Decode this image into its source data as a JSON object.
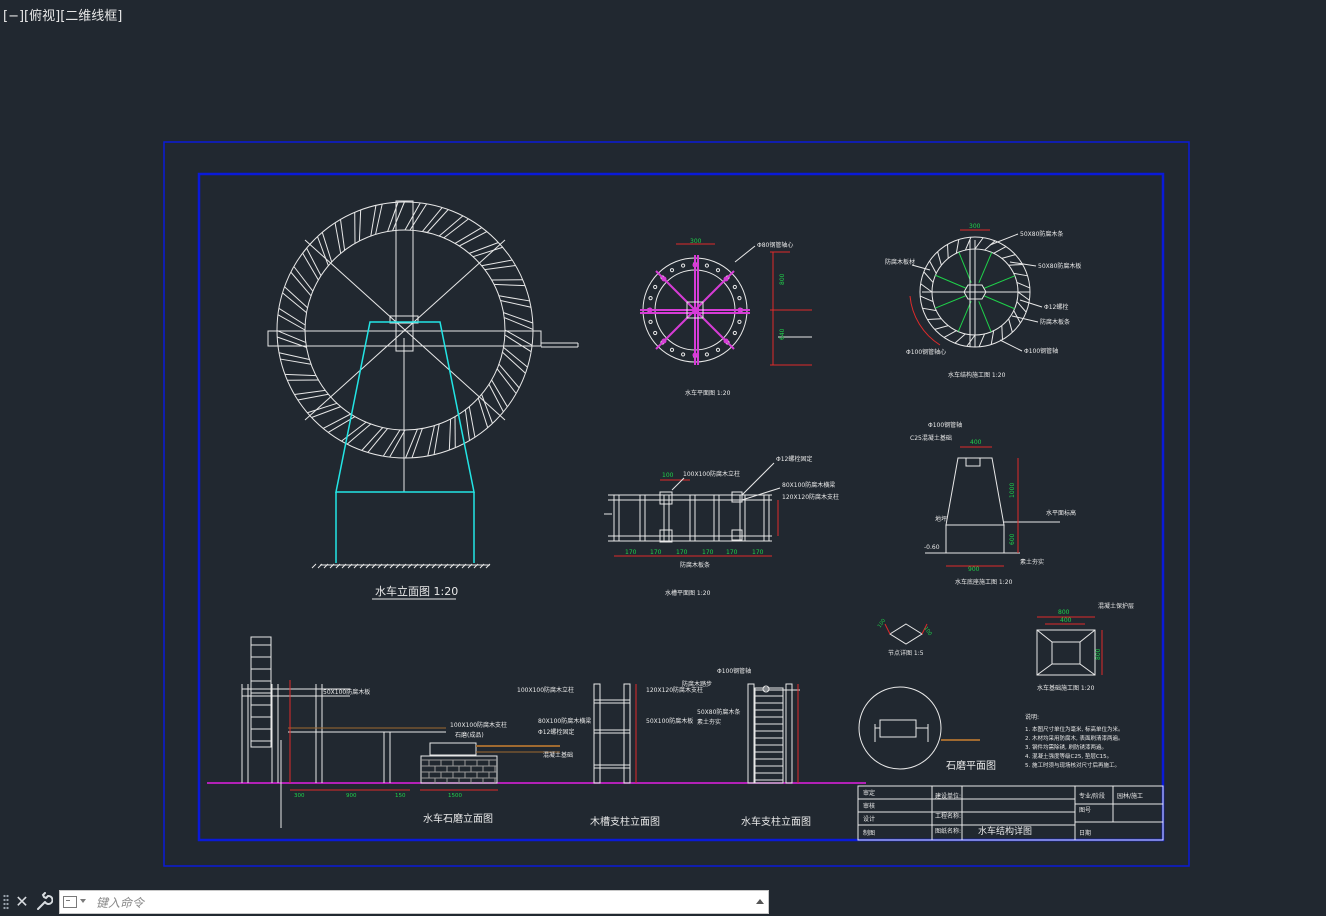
{
  "viewport": {
    "minus": "[−]",
    "view": "[俯视]",
    "style": "[二维线框]"
  },
  "titles": {
    "elevation": "水车立面图  1:20",
    "wheel_elev": "水车平面图  1:20",
    "wheel_section": "水车结构施工图  1:20",
    "trough_plan": "水槽平面图  1:20",
    "pedestal": "水车底座施工图  1:20",
    "joint": "节点详图  1:5",
    "footing": "水车基础施工图  1:20",
    "stone_plan": "石磨平面图",
    "stone_elev": "水车石磨立面图",
    "trough_support": "木槽支柱立面图",
    "wheel_support": "水车支柱立面图"
  },
  "callouts": {
    "c1": "Φ80钢管轴心",
    "c2": "50X80防腐木条",
    "c3": "50X80防腐木板",
    "c4": "Φ12螺栓",
    "c5": "防腐木板条",
    "c6": "Φ100钢管轴",
    "c7": "C25混凝土基础",
    "c8": "地坪",
    "c9": "素土夯实",
    "c10": "100X100防腐木立柱",
    "c11": "Φ12螺栓固定",
    "c12": "80X100防腐木横梁",
    "c13": "120X120防腐木支柱",
    "c14": "Φ100钢管轴",
    "c15": "石磨(成品)",
    "c16": "50X100防腐木板",
    "c17": "100X100防腐木支柱",
    "c18": "混凝土基础",
    "c19": "防腐木踏步",
    "c20": "Φ100钢管轴心",
    "c21": "混凝土保护层",
    "c22": "防腐木板材",
    "c23": "水平面标高"
  },
  "dims": {
    "d300": "300",
    "d800": "800",
    "d640": "640",
    "d100": "100",
    "d170": "170",
    "d400": "400",
    "d1000": "1000",
    "d900": "900",
    "d600": "600",
    "d1500": "1500",
    "d150": "150",
    "dneg": "-0.60"
  },
  "notes": {
    "heading": "说明:",
    "lines": [
      "1. 本图尺寸单位为毫米, 标高单位为米。",
      "2. 木材均采用防腐木, 表面刷清漆两遍。",
      "3. 钢件均需除锈, 刷防锈漆两遍。",
      "4. 混凝土强度等级C25, 垫层C15。",
      "5. 施工时须与现场核对尺寸后再施工。"
    ]
  },
  "titleblock": {
    "r1": "审定",
    "r2": "审核",
    "r3": "设计",
    "r4": "制图",
    "p1": "建设单位:",
    "p2": "工程名称:",
    "p3": "图纸名称:",
    "drawing_name": "水车结构详图",
    "k1": "图号",
    "k2": "日期",
    "k3": "专业/阶段",
    "k4": "园林/施工"
  },
  "command": {
    "placeholder": "键入命令"
  },
  "colors": {
    "background": "#212830",
    "frame": "#0a1ad8",
    "line": "#e8e8e8",
    "accent_cyan": "#22e5e5",
    "ground_magenta": "#e21fe2",
    "dim_green": "#1fd14a",
    "dim_red": "#e02a2a",
    "beam_brown": "#a06a30"
  }
}
